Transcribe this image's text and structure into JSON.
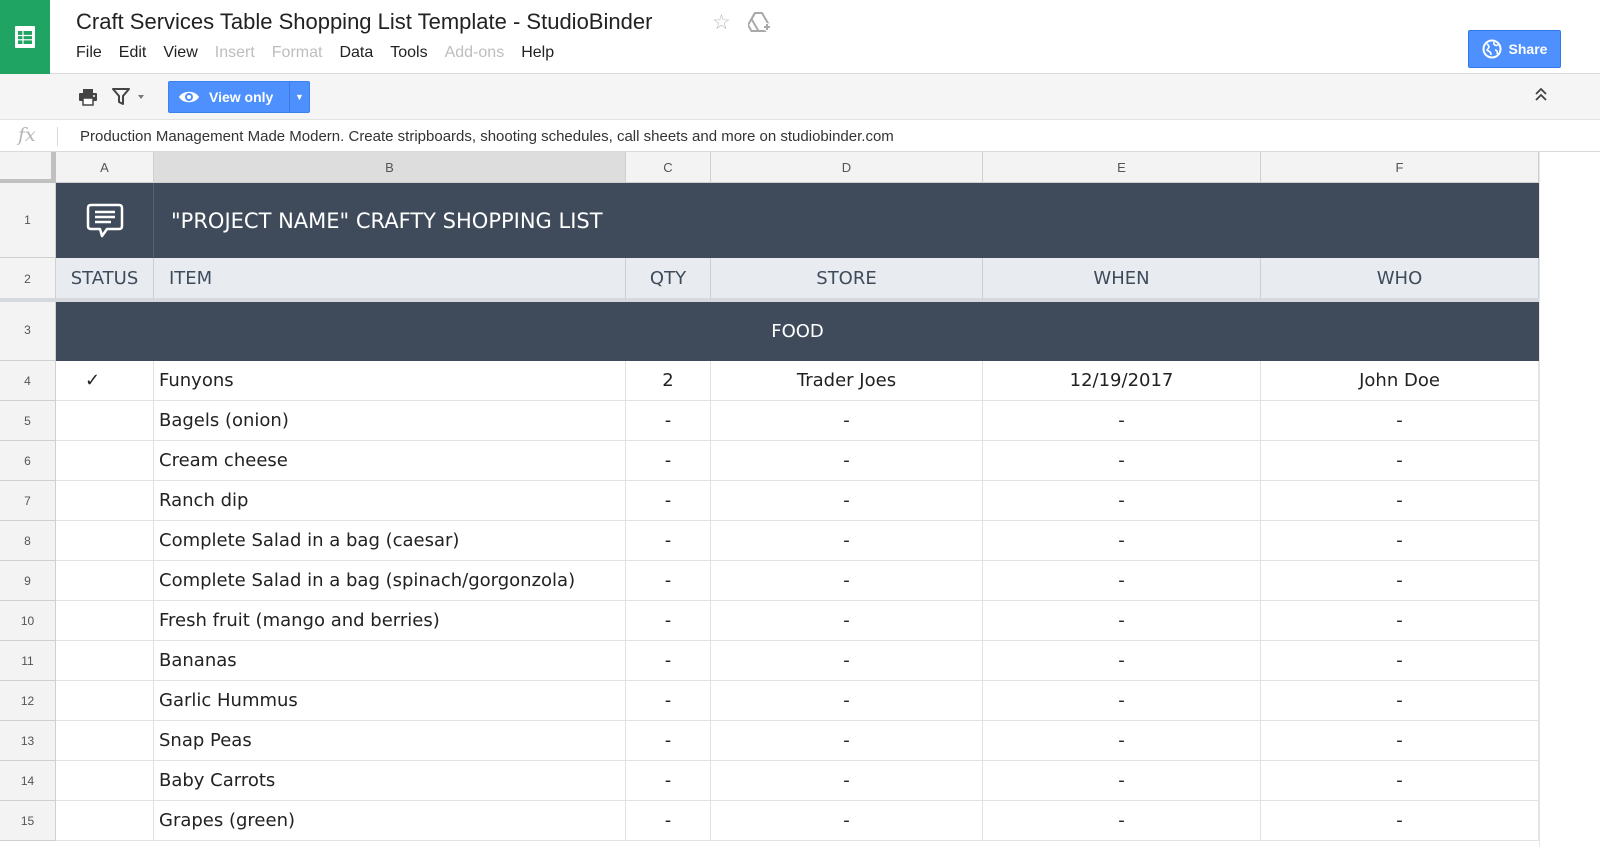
{
  "app": {
    "title": "Craft Services Table Shopping List Template - StudioBinder",
    "logo_icon": "sheets-logo-icon",
    "star_icon": "star-outline-icon",
    "drive_icon": "drive-icon",
    "brand_color": "#20a464"
  },
  "menu": [
    "File",
    "Edit",
    "View",
    "Insert",
    "Format",
    "Data",
    "Tools",
    "Add-ons",
    "Help"
  ],
  "menu_disabled": [
    "Insert",
    "Format",
    "Add-ons"
  ],
  "share": {
    "label": "Share",
    "icon": "globe-icon",
    "color": "#4d90fe"
  },
  "toolbar": {
    "print_icon": "printer-icon",
    "filter_icon": "filter-icon",
    "view_only_label": "View only",
    "view_icon": "eye-icon",
    "collapse_icon": "double-chevron-up-icon"
  },
  "formula_bar": {
    "fx_label": "fx",
    "content": "Production Management Made Modern. Create stripboards, shooting schedules, call sheets and more on studiobinder.com"
  },
  "columns": [
    "A",
    "B",
    "C",
    "D",
    "E",
    "F"
  ],
  "row_numbers": [
    "1",
    "2",
    "3",
    "4",
    "5",
    "6",
    "7",
    "8",
    "9",
    "10",
    "11",
    "12",
    "13",
    "14",
    "15"
  ],
  "sheet": {
    "banner_icon": "chat-bubble-icon",
    "banner_title": "\"PROJECT NAME\" CRAFTY SHOPPING LIST",
    "banner_color": "#3f4b5b",
    "header_row": [
      "STATUS",
      "ITEM",
      "QTY",
      "STORE",
      "WHEN",
      "WHO"
    ],
    "section_label": "FOOD",
    "rows": [
      [
        "✓",
        "Funyons",
        "2",
        "Trader Joes",
        "12/19/2017",
        "John Doe"
      ],
      [
        "",
        "Bagels (onion)",
        "-",
        "-",
        "-",
        "-"
      ],
      [
        "",
        "Cream cheese",
        "-",
        "-",
        "-",
        "-"
      ],
      [
        "",
        "Ranch dip",
        "-",
        "-",
        "-",
        "-"
      ],
      [
        "",
        "Complete Salad in a bag (caesar)",
        "-",
        "-",
        "-",
        "-"
      ],
      [
        "",
        "Complete Salad in a bag (spinach/gorgonzola)",
        "-",
        "-",
        "-",
        "-"
      ],
      [
        "",
        "Fresh fruit (mango and berries)",
        "-",
        "-",
        "-",
        "-"
      ],
      [
        "",
        "Bananas",
        "-",
        "-",
        "-",
        "-"
      ],
      [
        "",
        "Garlic Hummus",
        "-",
        "-",
        "-",
        "-"
      ],
      [
        "",
        "Snap Peas",
        "-",
        "-",
        "-",
        "-"
      ],
      [
        "",
        "Baby Carrots",
        "-",
        "-",
        "-",
        "-"
      ],
      [
        "",
        "Grapes (green)",
        "-",
        "-",
        "-",
        "-"
      ]
    ]
  }
}
